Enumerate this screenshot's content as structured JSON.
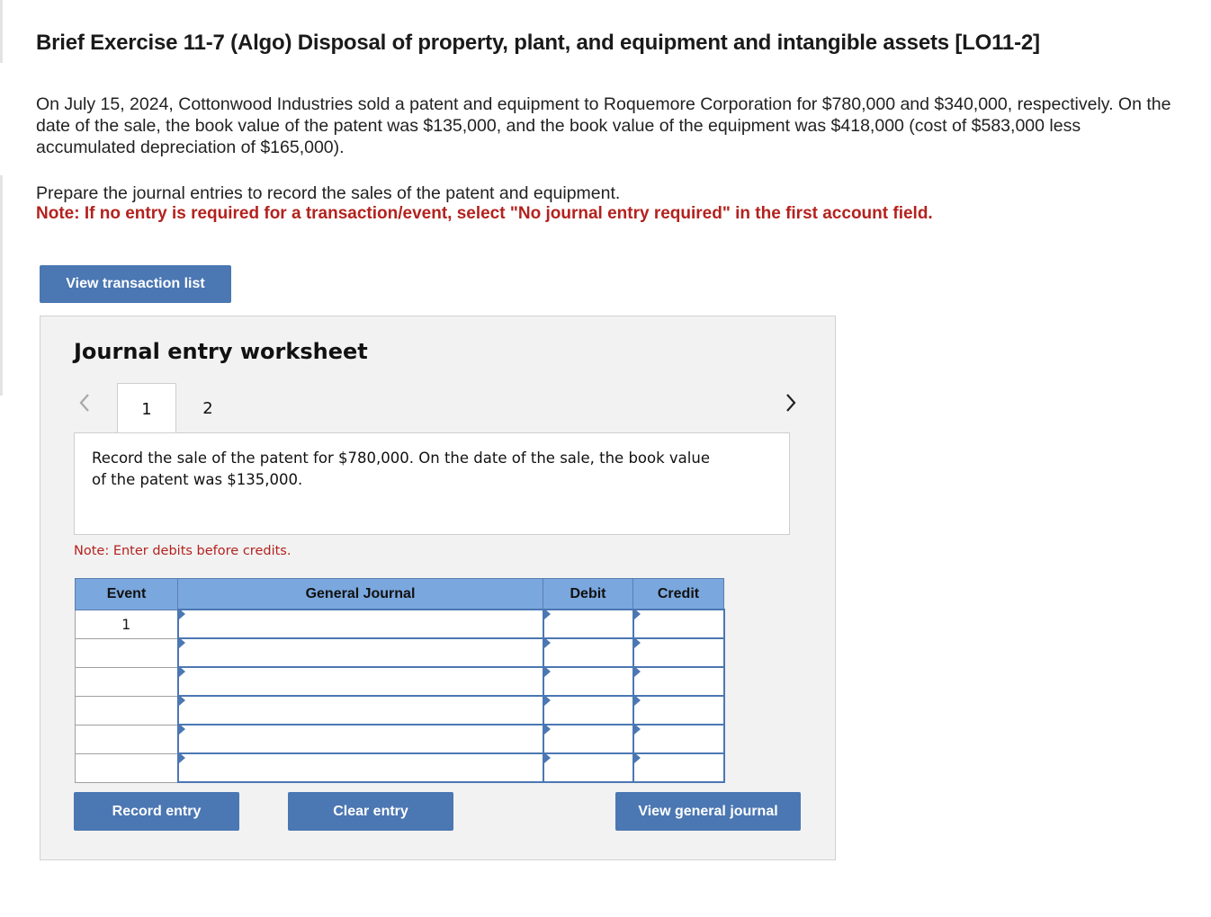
{
  "header": {
    "title": "Brief Exercise 11-7 (Algo) Disposal of property, plant, and equipment and intangible assets [LO11-2]"
  },
  "problem": {
    "paragraph1": "On July 15, 2024, Cottonwood Industries sold a patent and equipment to Roquemore Corporation for $780,000 and $340,000, respectively. On the date of the sale, the book value of the patent was $135,000, and the book value of the equipment was $418,000 (cost of $583,000 less accumulated depreciation of $165,000).",
    "paragraph2": "Prepare the journal entries to record the sales of the patent and equipment.",
    "note": "Note: If no entry is required for a transaction/event, select \"No journal entry required\" in the first account field."
  },
  "buttons": {
    "view_transaction_list": "View transaction list",
    "record_entry": "Record entry",
    "clear_entry": "Clear entry",
    "view_general_journal": "View general journal"
  },
  "worksheet": {
    "title": "Journal entry worksheet",
    "tabs": [
      {
        "label": "1",
        "active": true
      },
      {
        "label": "2",
        "active": false
      }
    ],
    "description": "Record the sale of the patent for $780,000. On the date of the sale, the book value of the patent was $135,000.",
    "note": "Note: Enter debits before credits.",
    "table": {
      "headers": [
        "Event",
        "General Journal",
        "Debit",
        "Credit"
      ],
      "rows": [
        {
          "event": "1",
          "account": "",
          "debit": "",
          "credit": ""
        },
        {
          "event": "",
          "account": "",
          "debit": "",
          "credit": ""
        },
        {
          "event": "",
          "account": "",
          "debit": "",
          "credit": ""
        },
        {
          "event": "",
          "account": "",
          "debit": "",
          "credit": ""
        },
        {
          "event": "",
          "account": "",
          "debit": "",
          "credit": ""
        },
        {
          "event": "",
          "account": "",
          "debit": "",
          "credit": ""
        }
      ]
    }
  },
  "icons": {
    "prev": "chevron-left-icon",
    "next": "chevron-right-icon"
  },
  "colors": {
    "button_blue": "#4b77b3",
    "header_blue": "#7aa7dd",
    "note_red": "#b3221e"
  }
}
